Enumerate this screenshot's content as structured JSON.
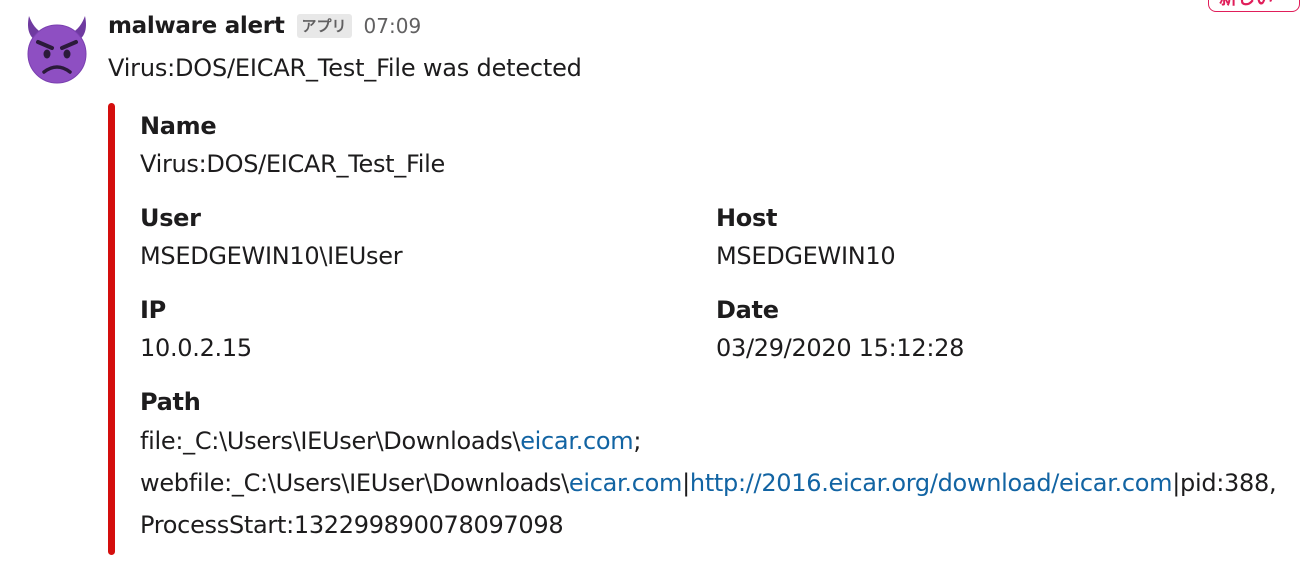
{
  "corner_badge": {
    "label": "新しい"
  },
  "message": {
    "sender": "malware alert",
    "app_tag": "アプリ",
    "time": "07:09",
    "text": "Virus:DOS/EICAR_Test_File was detected",
    "avatar_icon": "smiling-imp-emoji-icon"
  },
  "attachment": {
    "accent_color": "#d40e0d",
    "fields": {
      "name": {
        "label": "Name",
        "value": "Virus:DOS/EICAR_Test_File"
      },
      "user": {
        "label": "User",
        "value": "MSEDGEWIN10\\IEUser"
      },
      "host": {
        "label": "Host",
        "value": "MSEDGEWIN10"
      },
      "ip": {
        "label": "IP",
        "value": "10.0.2.15"
      },
      "date": {
        "label": "Date",
        "value": "03/29/2020 15:12:28"
      },
      "path": {
        "label": "Path",
        "seg1": "file:_C:\\Users\\IEUser\\Downloads\\",
        "link1": "eicar.com",
        "seg2": ";",
        "seg3": "webfile:_C:\\Users\\IEUser\\Downloads\\",
        "link2": "eicar.com",
        "seg4": "|",
        "link3": "http://2016.eicar.org/download/eicar.com",
        "seg5": "|pid:388,ProcessStart:132299890078097098"
      }
    }
  },
  "colors": {
    "link": "#1264a3",
    "text": "#1d1c1d",
    "muted": "#616061",
    "badge": "#e01e5a"
  }
}
